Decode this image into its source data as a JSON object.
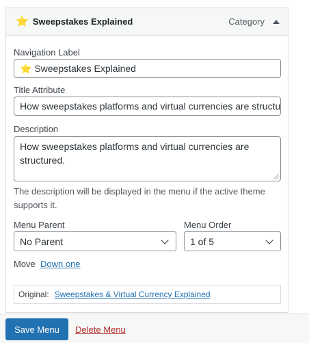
{
  "menu_item": {
    "header_title": "Sweepstakes Explained",
    "item_type": "Category",
    "star_icon": "⭐"
  },
  "fields": {
    "navigation_label": {
      "label": "Navigation Label",
      "value": "⭐ Sweepstakes Explained"
    },
    "title_attribute": {
      "label": "Title Attribute",
      "value": "How sweepstakes platforms and virtual currencies are structured."
    },
    "description": {
      "label": "Description",
      "value": "How sweepstakes platforms and virtual currencies are structured.",
      "hint": "The description will be displayed in the menu if the active theme supports it."
    },
    "menu_parent": {
      "label": "Menu Parent",
      "selected": "No Parent"
    },
    "menu_order": {
      "label": "Menu Order",
      "selected": "1 of 5"
    }
  },
  "move": {
    "label": "Move",
    "down_one": "Down one"
  },
  "original": {
    "label": "Original:",
    "link_text": "Sweepstakes & Virtual Currency Explained"
  },
  "footer": {
    "save_label": "Save Menu",
    "delete_label": "Delete Menu"
  }
}
